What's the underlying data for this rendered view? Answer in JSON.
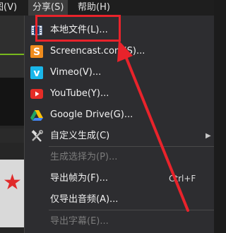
{
  "menubar": {
    "items": [
      {
        "label": "图(V)"
      },
      {
        "label": "分享(S)"
      },
      {
        "label": "帮助(H)"
      }
    ]
  },
  "share_menu": {
    "items": [
      {
        "label": "本地文件(L)...",
        "icon": "film-icon",
        "enabled": true
      },
      {
        "label": "Screencast.com(S)...",
        "icon": "screencast-icon",
        "enabled": true
      },
      {
        "label": "Vimeo(V)...",
        "icon": "vimeo-icon",
        "enabled": true
      },
      {
        "label": "YouTube(Y)...",
        "icon": "youtube-icon",
        "enabled": true
      },
      {
        "label": "Google Drive(G)...",
        "icon": "google-drive-icon",
        "enabled": true
      },
      {
        "label": "自定义生成(C)",
        "icon": "tools-icon",
        "enabled": true,
        "submenu": true
      },
      {
        "label": "生成选择为(P)...",
        "enabled": false
      },
      {
        "label": "导出帧为(F)...",
        "shortcut": "Ctrl+F",
        "enabled": true
      },
      {
        "label": "仅导出音频(A)...",
        "enabled": true
      },
      {
        "label": "导出字幕(E)...",
        "enabled": false
      }
    ]
  },
  "annotation": {
    "highlight_color": "#e8232b",
    "arrow_color": "#e8232b"
  },
  "colors": {
    "menu_bg": "#2d2d30",
    "text": "#f2f2f2",
    "disabled_text": "#7b7b7b",
    "accent_green": "#78b91e"
  }
}
